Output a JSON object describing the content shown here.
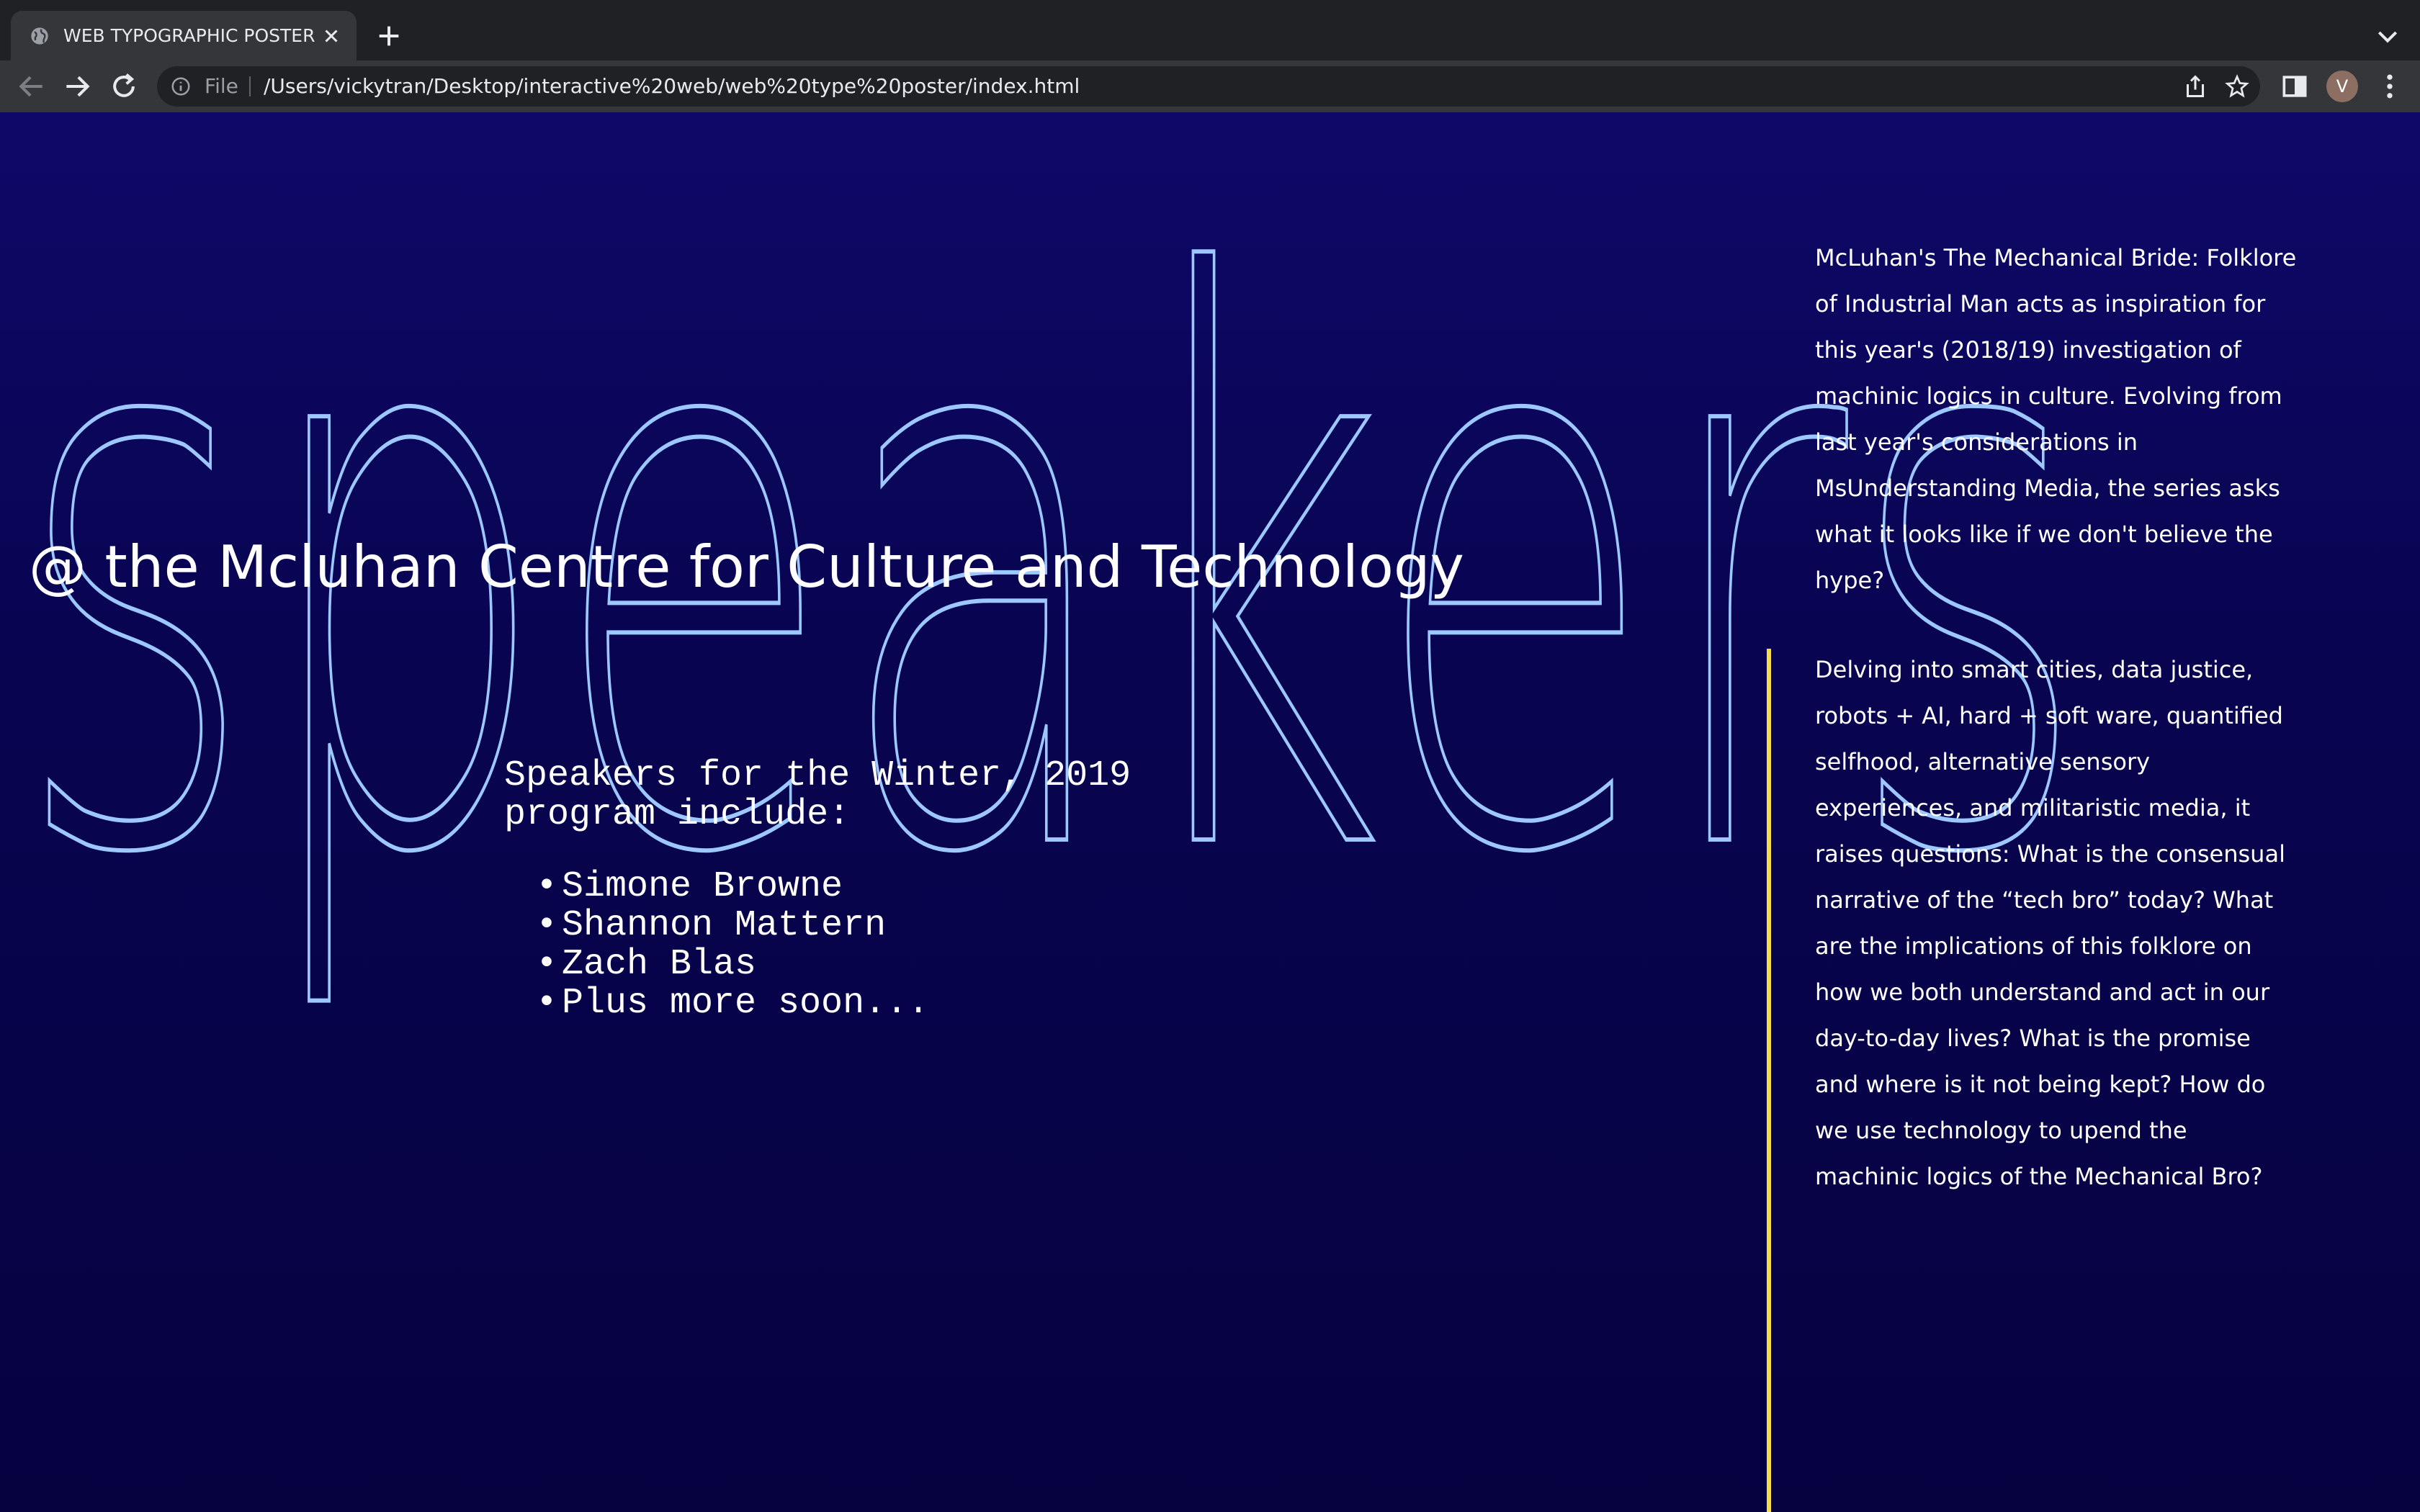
{
  "browser": {
    "tab_title": "WEB TYPOGRAPHIC POSTER",
    "scheme_label": "File",
    "url": "/Users/vickytran/Desktop/interactive%20web/web%20type%20poster/index.html",
    "avatar_letter": "V"
  },
  "poster": {
    "headline": "speakers",
    "subtitle": "@ the Mcluhan Centre for Culture and Technology",
    "speakers_intro": "Speakers for the Winter, 2019 program include:",
    "speakers": [
      "Simone Browne",
      "Shannon Mattern",
      "Zach Blas",
      "Plus more soon..."
    ],
    "paragraph_1": "McLuhan's The Mechanical Bride: Folklore of Industrial Man acts as inspiration for this year's (2018/19) investigation of machinic logics in culture. Evolving from last year's considerations in MsUnderstanding Media, the series asks what it looks like if we don't believe the hype?",
    "paragraph_2": "Delving into smart cities, data justice, robots + AI, hard + soft ware, quantified selfhood, alternative sensory experiences, and militaristic media, it raises questions: What is the consensual narrative of the “tech bro” today? What are the implications of this folklore on how we both understand and act in our day-to-day lives? What is the promise and where is it not being kept? How do we use technology to upend the machinic logics of the Mechanical Bro?"
  },
  "colors": {
    "background": "#080450",
    "headline_stroke": "#9cc8ff",
    "accent_rule": "#f5dd4a",
    "text": "#ffffff"
  }
}
